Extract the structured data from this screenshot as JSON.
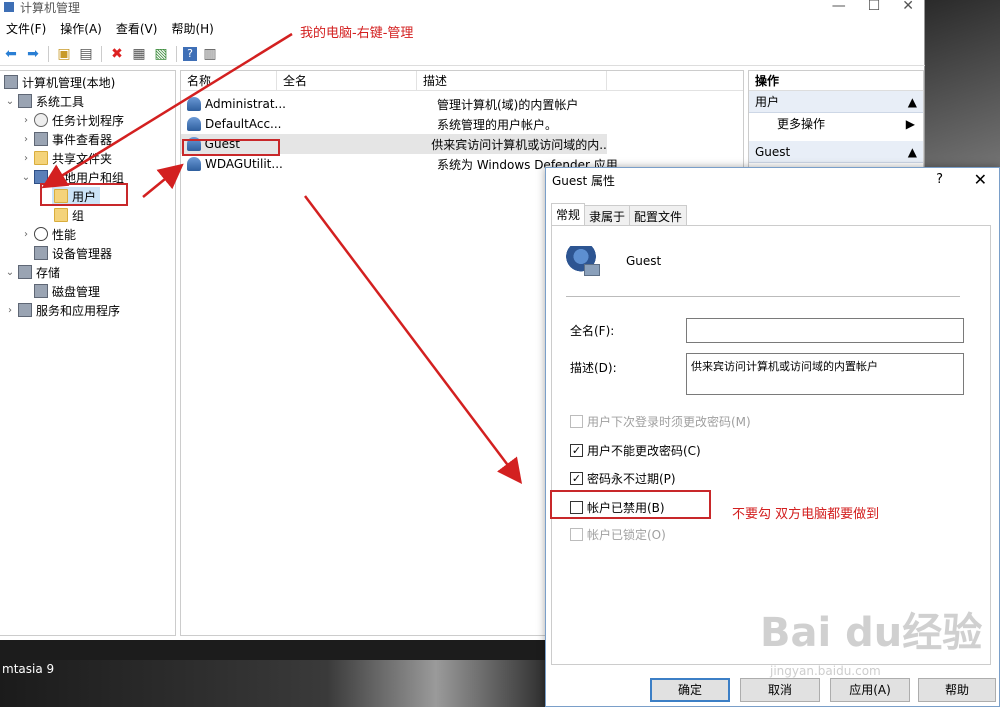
{
  "window": {
    "title": "计算机管理",
    "minimize": "—",
    "maximize": "☐",
    "close": "✕"
  },
  "menu": [
    "文件(F)",
    "操作(A)",
    "查看(V)",
    "帮助(H)"
  ],
  "tree": {
    "root": "计算机管理(本地)",
    "system_tools": "系统工具",
    "task_scheduler": "任务计划程序",
    "event_viewer": "事件查看器",
    "shared_folders": "共享文件夹",
    "local_users": "本地用户和组",
    "users": "用户",
    "groups": "组",
    "performance": "性能",
    "device_manager": "设备管理器",
    "storage": "存储",
    "disk_mgmt": "磁盘管理",
    "services": "服务和应用程序"
  },
  "list": {
    "headers": {
      "name": "名称",
      "full": "全名",
      "desc": "描述"
    },
    "rows": [
      {
        "name": "Administrat...",
        "full": "",
        "desc": "管理计算机(域)的内置帐户"
      },
      {
        "name": "DefaultAcc...",
        "full": "",
        "desc": "系统管理的用户帐户。"
      },
      {
        "name": "Guest",
        "full": "",
        "desc": "供来宾访问计算机或访问域的内..."
      },
      {
        "name": "WDAGUtilit...",
        "full": "",
        "desc": "系统为 Windows Defender 应用..."
      }
    ]
  },
  "actions": {
    "title": "操作",
    "section_users": "用户",
    "more_actions": "更多操作",
    "section_guest": "Guest"
  },
  "dialog": {
    "title": "Guest 属性",
    "help": "?",
    "close": "✕",
    "tabs": [
      "常规",
      "隶属于",
      "配置文件"
    ],
    "user_name": "Guest",
    "fullname_label": "全名(F):",
    "fullname_value": "",
    "desc_label": "描述(D):",
    "desc_value": "供来宾访问计算机或访问域的内置帐户",
    "opt_change_pwd": "用户下次登录时须更改密码(M)",
    "opt_cannot_change": "用户不能更改密码(C)",
    "opt_never_expire": "密码永不过期(P)",
    "opt_disabled": "帐户已禁用(B)",
    "opt_locked": "帐户已锁定(O)",
    "check_mark": "✓",
    "btn_ok": "确定",
    "btn_cancel": "取消",
    "btn_apply": "应用(A)",
    "btn_help": "帮助"
  },
  "annotations": {
    "top": "我的电脑-右键-管理",
    "bottom": "不要勾  双方电脑都要做到"
  },
  "taskbar": "mtasia 9",
  "watermark": {
    "brand": "Bai du经验",
    "url": "jingyan.baidu.com"
  },
  "colors": {
    "annotation_red": "#d32020",
    "selection": "#cce4f7"
  }
}
